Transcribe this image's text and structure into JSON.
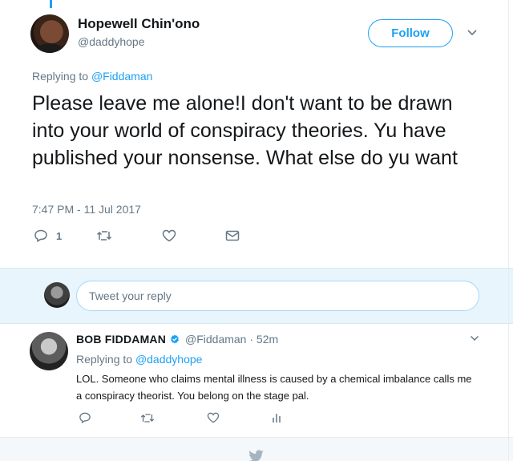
{
  "main_tweet": {
    "author_name": "Hopewell Chin'ono",
    "author_handle": "@daddyhope",
    "follow_label": "Follow",
    "replying_prefix": "Replying to",
    "replying_mention": "@Fiddaman",
    "text": "Please leave me alone!I don't want to be drawn into your world of conspiracy theories. Yu have published your nonsense. What else do yu want",
    "timestamp": "7:47 PM - 11 Jul 2017",
    "reply_count": "1",
    "icons": [
      "reply-icon",
      "retweet-icon",
      "like-icon",
      "direct-message-icon",
      "chevron-down-icon"
    ]
  },
  "composer": {
    "placeholder": "Tweet your reply"
  },
  "reply_tweet": {
    "author_name": "BOB FIDDAMAN",
    "author_handle": "@Fiddaman · 52m",
    "replying_prefix": "Replying to",
    "replying_mention": "@daddyhope",
    "text": "LOL. Someone who claims mental illness is caused by a chemical imbalance calls me a conspiracy theorist. You belong on the stage pal.",
    "icons": [
      "reply-icon",
      "retweet-icon",
      "like-icon",
      "analytics-icon",
      "verified-icon"
    ]
  },
  "colors": {
    "brand_blue": "#1da1f2",
    "text_dark": "#14171a",
    "text_gray": "#657786",
    "composer_bg": "#e8f5fd"
  }
}
